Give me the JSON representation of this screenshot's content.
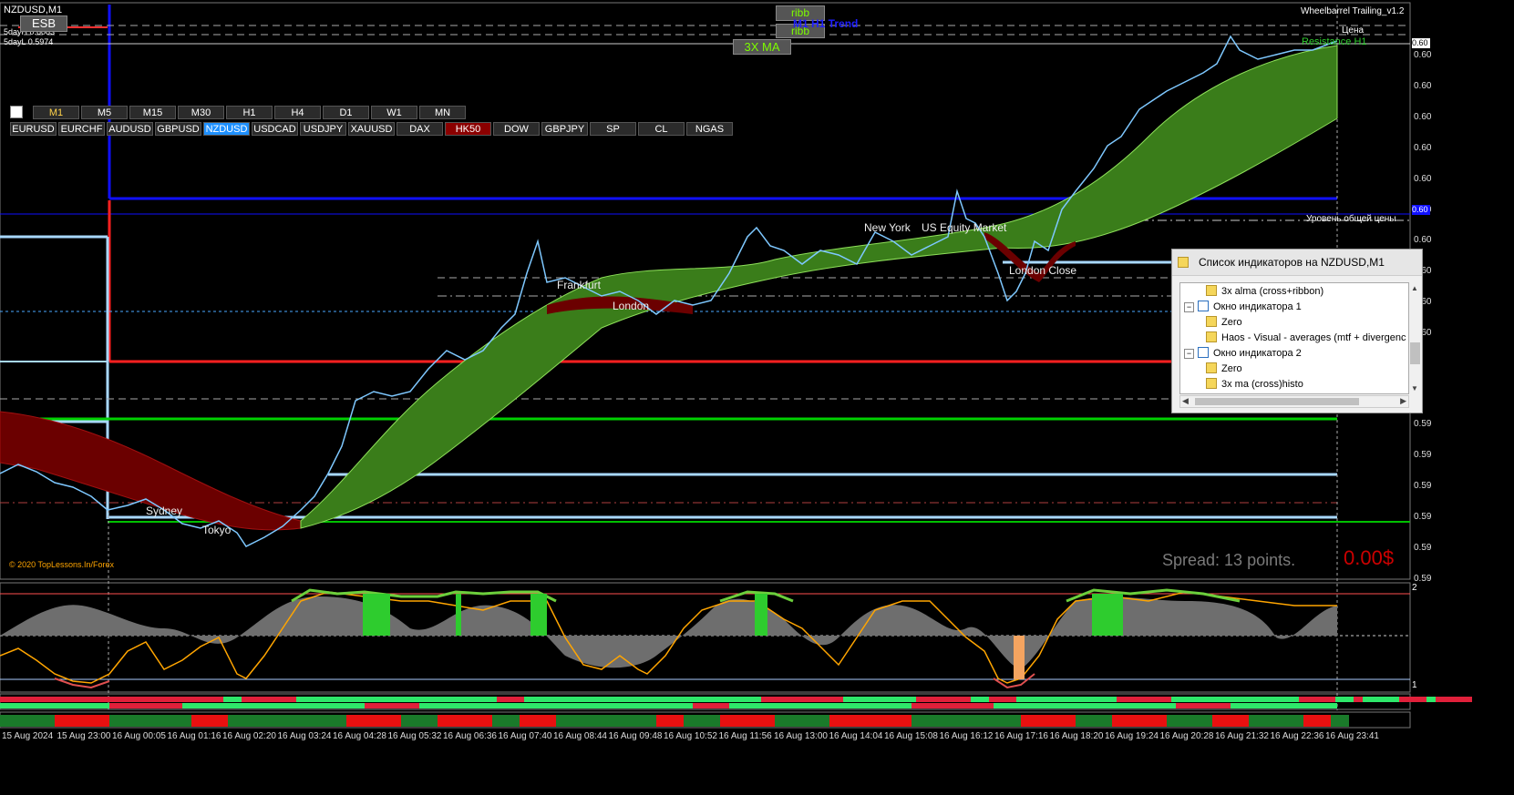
{
  "window": {
    "title": "NZDUSD,M1",
    "day_high": "5dayH 0.6083",
    "day_low": "5dayL 0.5974",
    "esb_label": "ESB",
    "ea_name": "Wheelbarrel Trailing_v1.2"
  },
  "top_labels": {
    "ribb_1": "ribb",
    "ribb_2": "ribb",
    "trend": "M1 H1 Trend",
    "ma3x": "3X MA",
    "price_label": "Цена",
    "resist_label": "Resistance H1",
    "common_level": "Уровень общей цены"
  },
  "timeframes": [
    {
      "label": "M1",
      "active": true
    },
    {
      "label": "M5",
      "active": false
    },
    {
      "label": "M15",
      "active": false
    },
    {
      "label": "M30",
      "active": false
    },
    {
      "label": "H1",
      "active": false
    },
    {
      "label": "H4",
      "active": false
    },
    {
      "label": "D1",
      "active": false
    },
    {
      "label": "W1",
      "active": false
    },
    {
      "label": "MN",
      "active": false
    }
  ],
  "symbols": [
    {
      "label": "EURUSD",
      "state": "normal"
    },
    {
      "label": "EURCHF",
      "state": "normal"
    },
    {
      "label": "AUDUSD",
      "state": "normal"
    },
    {
      "label": "GBPUSD",
      "state": "normal"
    },
    {
      "label": "NZDUSD",
      "state": "active"
    },
    {
      "label": "USDCAD",
      "state": "normal"
    },
    {
      "label": "USDJPY",
      "state": "normal"
    },
    {
      "label": "XAUUSD",
      "state": "normal"
    },
    {
      "label": "DAX",
      "state": "normal"
    },
    {
      "label": "HK50",
      "state": "alert"
    },
    {
      "label": "DOW",
      "state": "normal"
    },
    {
      "label": "GBPJPY",
      "state": "normal"
    },
    {
      "label": "SP",
      "state": "normal"
    },
    {
      "label": "CL",
      "state": "normal"
    },
    {
      "label": "NGAS",
      "state": "normal"
    }
  ],
  "sessions": {
    "sydney": "Sydney",
    "tokyo": "Tokyo",
    "frankfurt": "Frankfurt",
    "london": "London",
    "new_york": "New York",
    "us_equity": "US Equity Market",
    "london_close": "London Close"
  },
  "price_axis": [
    "0.60",
    "0.60",
    "0.60",
    "0.60",
    "0.60",
    "0.60",
    "0.60",
    "0.60",
    "0.60",
    "0.60",
    "0.59",
    "0.59",
    "0.59",
    "0.59",
    "0.59",
    "0.59"
  ],
  "price_tag_current": "0.60",
  "price_tag_level": "0.60",
  "indicator_axis": {
    "top": "2",
    "bottom": "1"
  },
  "time_axis": [
    "15 Aug 2024",
    "15 Aug 23:00",
    "16 Aug 00:05",
    "16 Aug 01:16",
    "16 Aug 02:20",
    "16 Aug 03:24",
    "16 Aug 04:28",
    "16 Aug 05:32",
    "16 Aug 06:36",
    "16 Aug 07:40",
    "16 Aug 08:44",
    "16 Aug 09:48",
    "16 Aug 10:52",
    "16 Aug 11:56",
    "16 Aug 13:00",
    "16 Aug 14:04",
    "16 Aug 15:08",
    "16 Aug 16:12",
    "16 Aug 17:16",
    "16 Aug 18:20",
    "16 Aug 19:24",
    "16 Aug 20:28",
    "16 Aug 21:32",
    "16 Aug 22:36",
    "16 Aug 23:41"
  ],
  "credit": "© 2020 TopLessons.In/Forex",
  "spread": "Spread: 13 points.",
  "profit": "0.00$",
  "indicator_panel": {
    "title": "Список индикаторов на NZDUSD,M1",
    "items": [
      {
        "label": "3x alma (cross+ribbon)",
        "kind": "indicator",
        "level": 2
      },
      {
        "label": "Окно индикатора 1",
        "kind": "window",
        "level": 1
      },
      {
        "label": "Zero",
        "kind": "indicator",
        "level": 2
      },
      {
        "label": "Haos - Visual - averages (mtf + divergenc",
        "kind": "indicator",
        "level": 2
      },
      {
        "label": "Окно индикатора 2",
        "kind": "window",
        "level": 1
      },
      {
        "label": "Zero",
        "kind": "indicator",
        "level": 2
      },
      {
        "label": "3x ma (cross)histo",
        "kind": "indicator",
        "level": 2
      }
    ]
  },
  "colors": {
    "bull_ribbon": "#3a7d1a",
    "bear_ribbon": "#6b0000",
    "support_blue": "#1010ff",
    "level_red": "#ff2020",
    "level_green": "#00d000",
    "light_blue": "#a8d8ff",
    "oscillator_orange": "#ffa500",
    "oscillator_green": "#6ccf3c",
    "histogram_gray": "#6e6e6e"
  }
}
